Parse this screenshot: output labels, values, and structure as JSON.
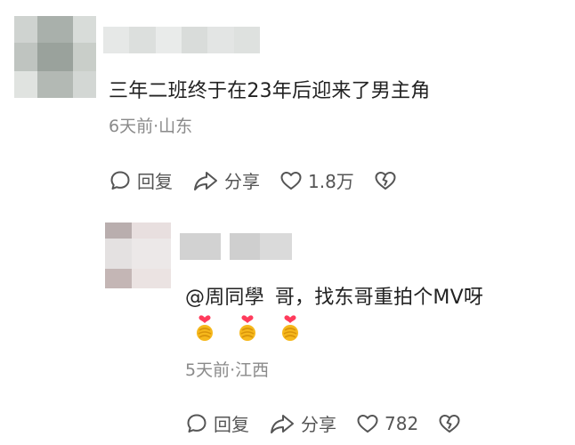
{
  "comment": {
    "text": "三年二班终于在23年后迎来了男主角",
    "meta": "6天前·山东",
    "actions": {
      "reply_label": "回复",
      "share_label": "分享",
      "like_count": "1.8万"
    },
    "icons": [
      "reply-bubble-icon",
      "share-arrow-icon",
      "heart-icon",
      "broken-heart-icon"
    ]
  },
  "reply": {
    "mention": "@周同學",
    "text": "哥，找东哥重拍个MV呀",
    "emoji_count": 3,
    "meta": "5天前·江西",
    "actions": {
      "reply_label": "回复",
      "share_label": "分享",
      "like_count": "782"
    }
  },
  "colors": {
    "text": "#222222",
    "meta": "#8a8a8a",
    "icon": "#555555",
    "emoji_heart": "#ff3b5c",
    "emoji_hand": "#f6b81c"
  }
}
